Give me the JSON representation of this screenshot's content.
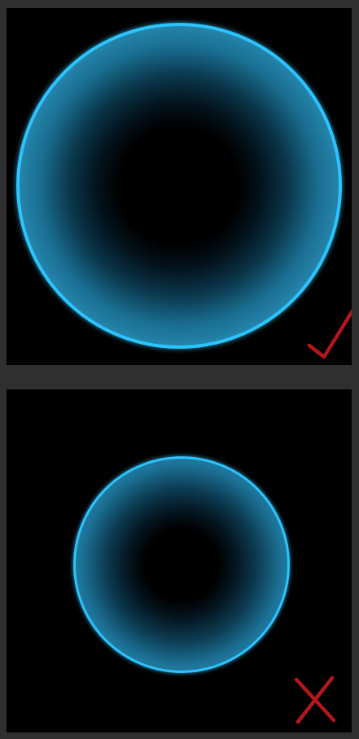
{
  "colors": {
    "background": "#2f2f2f",
    "panel": "#000000",
    "ring_edge": "#2bc4ff",
    "ring_body": "#2f9cc8",
    "mark": "#b3171b"
  },
  "panels": [
    {
      "ring": "large-glow-ring",
      "mark_icon": "checkmark-icon"
    },
    {
      "ring": "small-glow-ring",
      "mark_icon": "cross-icon"
    }
  ]
}
